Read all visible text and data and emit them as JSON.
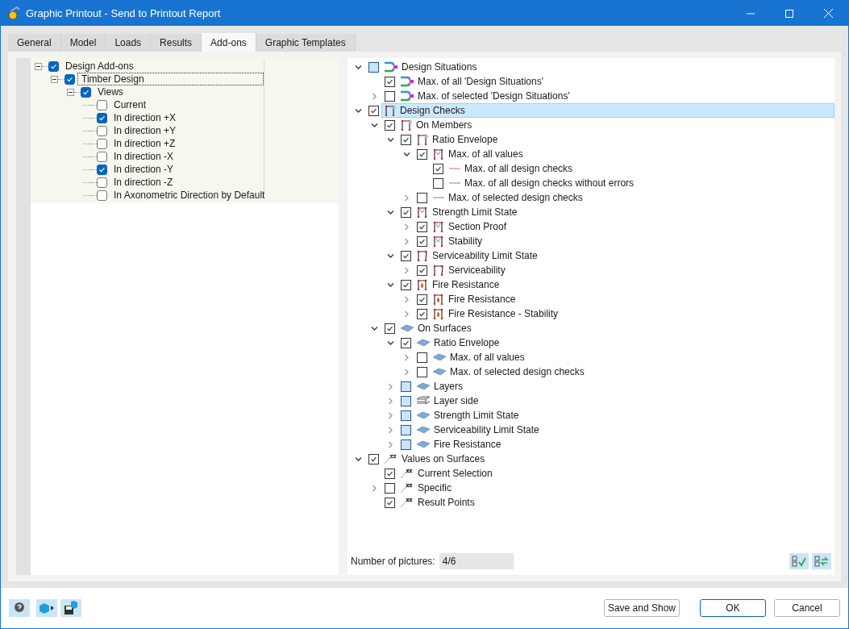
{
  "window": {
    "title": "Graphic Printout - Send to Printout Report"
  },
  "tabs": [
    {
      "label": "General",
      "selected": false
    },
    {
      "label": "Model",
      "selected": false
    },
    {
      "label": "Loads",
      "selected": false
    },
    {
      "label": "Results",
      "selected": false
    },
    {
      "label": "Add-ons",
      "selected": true
    },
    {
      "label": "Graphic Templates",
      "selected": false
    }
  ],
  "views_tree": [
    {
      "label": "Design Add-ons",
      "checked": true,
      "expanded": true,
      "selected": false,
      "children": [
        {
          "label": "Timber Design",
          "checked": true,
          "expanded": true,
          "selected": true,
          "children": [
            {
              "label": "Views",
              "checked": true,
              "expanded": true,
              "selected": false,
              "children": [
                {
                  "label": "Current",
                  "checked": false,
                  "selected": false
                },
                {
                  "label": "In direction +X",
                  "checked": true,
                  "selected": false
                },
                {
                  "label": "In direction +Y",
                  "checked": false,
                  "selected": false
                },
                {
                  "label": "In direction +Z",
                  "checked": false,
                  "selected": false
                },
                {
                  "label": "In direction -X",
                  "checked": false,
                  "selected": false
                },
                {
                  "label": "In direction -Y",
                  "checked": true,
                  "selected": false
                },
                {
                  "label": "In direction -Z",
                  "checked": false,
                  "selected": false
                },
                {
                  "label": "In Axonometric Direction by Default",
                  "checked": false,
                  "selected": false
                }
              ]
            }
          ]
        }
      ]
    }
  ],
  "checks_tree": [
    {
      "label": "Design Situations",
      "kind": "situation",
      "checked": false,
      "partial": true,
      "expanded": true,
      "selected": false,
      "children": [
        {
          "label": "Max. of all 'Design Situations'",
          "kind": "situation",
          "checked": true,
          "partial": false,
          "selected": false
        },
        {
          "label": "Max. of selected 'Design Situations'",
          "kind": "situation",
          "checked": false,
          "partial": false,
          "expanded": false,
          "selected": false
        }
      ]
    },
    {
      "label": "Design Checks",
      "kind": "member",
      "checked": true,
      "partial": false,
      "expanded": true,
      "selected": true,
      "children": [
        {
          "label": "On Members",
          "kind": "member",
          "checked": true,
          "partial": false,
          "expanded": true,
          "selected": false,
          "children": [
            {
              "label": "Ratio Envelope",
              "kind": "member",
              "checked": true,
              "partial": false,
              "expanded": true,
              "selected": false,
              "children": [
                {
                  "label": "Max. of all values",
                  "kind": "member-max",
                  "checked": true,
                  "partial": false,
                  "expanded": true,
                  "selected": false,
                  "children": [
                    {
                      "label": "Max. of all design checks",
                      "kind": "line-red",
                      "checked": true,
                      "partial": false,
                      "selected": false
                    },
                    {
                      "label": "Max. of all design checks without errors",
                      "kind": "line-grey",
                      "checked": false,
                      "partial": false,
                      "selected": false
                    }
                  ]
                },
                {
                  "label": "Max. of selected design checks",
                  "kind": "line-grey",
                  "checked": false,
                  "partial": false,
                  "expanded": false,
                  "selected": false
                }
              ]
            },
            {
              "label": "Strength Limit State",
              "kind": "member-max",
              "checked": true,
              "partial": false,
              "expanded": true,
              "selected": false,
              "children": [
                {
                  "label": "Section Proof",
                  "kind": "member-max",
                  "checked": true,
                  "partial": false,
                  "expanded": false,
                  "selected": false
                },
                {
                  "label": "Stability",
                  "kind": "member-max",
                  "checked": true,
                  "partial": false,
                  "expanded": false,
                  "selected": false
                }
              ]
            },
            {
              "label": "Serviceability Limit State",
              "kind": "sls",
              "checked": true,
              "partial": false,
              "expanded": true,
              "selected": false,
              "children": [
                {
                  "label": "Serviceability",
                  "kind": "sls",
                  "checked": true,
                  "partial": false,
                  "expanded": false,
                  "selected": false
                }
              ]
            },
            {
              "label": "Fire Resistance",
              "kind": "fire",
              "checked": true,
              "partial": false,
              "expanded": true,
              "selected": false,
              "children": [
                {
                  "label": "Fire Resistance",
                  "kind": "fire",
                  "checked": true,
                  "partial": false,
                  "expanded": false,
                  "selected": false
                },
                {
                  "label": "Fire Resistance - Stability",
                  "kind": "fire",
                  "checked": true,
                  "partial": false,
                  "expanded": false,
                  "selected": false
                }
              ]
            }
          ]
        },
        {
          "label": "On Surfaces",
          "kind": "surface",
          "checked": true,
          "partial": false,
          "expanded": true,
          "selected": false,
          "children": [
            {
              "label": "Ratio Envelope",
              "kind": "surface",
              "checked": true,
              "partial": false,
              "expanded": true,
              "selected": false,
              "children": [
                {
                  "label": "Max. of all values",
                  "kind": "surface",
                  "checked": false,
                  "partial": false,
                  "expanded": false,
                  "selected": false
                },
                {
                  "label": "Max. of selected design checks",
                  "kind": "surface",
                  "checked": false,
                  "partial": false,
                  "expanded": false,
                  "selected": false
                }
              ]
            },
            {
              "label": "Layers",
              "kind": "surface",
              "checked": false,
              "partial": true,
              "expanded": false,
              "selected": false
            },
            {
              "label": "Layer side",
              "kind": "layers",
              "checked": false,
              "partial": true,
              "expanded": false,
              "selected": false
            },
            {
              "label": "Strength Limit State",
              "kind": "surface",
              "checked": false,
              "partial": true,
              "expanded": false,
              "selected": false
            },
            {
              "label": "Serviceability Limit State",
              "kind": "surface",
              "checked": false,
              "partial": true,
              "expanded": false,
              "selected": false
            },
            {
              "label": "Fire Resistance",
              "kind": "surface",
              "checked": false,
              "partial": true,
              "expanded": false,
              "selected": false
            }
          ]
        }
      ]
    },
    {
      "label": "Values on Surfaces",
      "kind": "values",
      "checked": true,
      "partial": false,
      "expanded": true,
      "selected": false,
      "children": [
        {
          "label": "Current Selection",
          "kind": "values",
          "checked": true,
          "partial": false,
          "selected": false
        },
        {
          "label": "Specific",
          "kind": "values",
          "checked": false,
          "partial": false,
          "expanded": false,
          "selected": false
        },
        {
          "label": "Result Points",
          "kind": "values",
          "checked": true,
          "partial": false,
          "selected": false
        }
      ]
    }
  ],
  "number_of_pictures": {
    "label": "Number of pictures:",
    "value": "4/6"
  },
  "footer_buttons": [
    {
      "label": "Save and Show",
      "default": false
    },
    {
      "label": "OK",
      "default": true
    },
    {
      "label": "Cancel",
      "default": false
    }
  ]
}
